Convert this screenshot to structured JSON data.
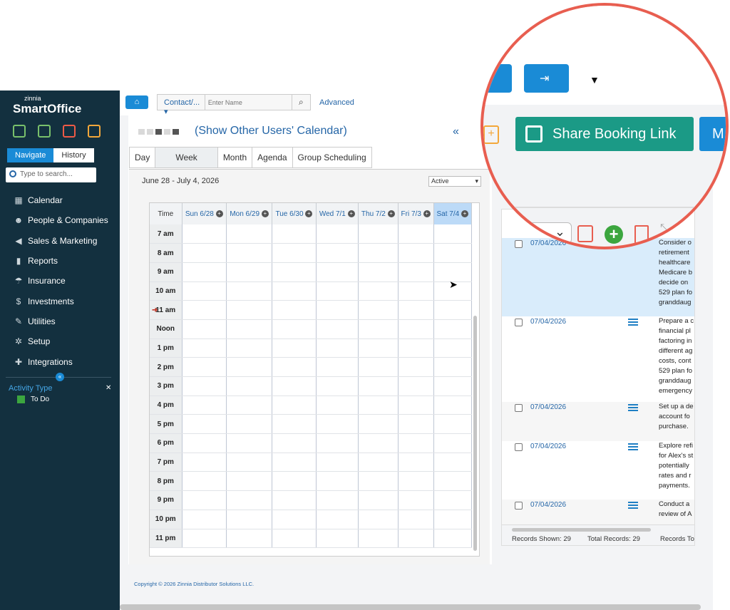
{
  "app": {
    "logo_small": "zinnia",
    "logo_big": "SmartOffice"
  },
  "sidebar": {
    "tab_navigate": "Navigate",
    "tab_history": "History",
    "search_placeholder": "Type to search...",
    "items": [
      {
        "label": "Calendar",
        "icon": "calendar-icon"
      },
      {
        "label": "People & Companies",
        "icon": "people-icon"
      },
      {
        "label": "Sales & Marketing",
        "icon": "megaphone-icon"
      },
      {
        "label": "Reports",
        "icon": "bar-chart-icon"
      },
      {
        "label": "Insurance",
        "icon": "umbrella-icon"
      },
      {
        "label": "Investments",
        "icon": "dollar-icon"
      },
      {
        "label": "Utilities",
        "icon": "wrench-icon"
      },
      {
        "label": "Setup",
        "icon": "gears-icon"
      },
      {
        "label": "Integrations",
        "icon": "puzzle-icon"
      }
    ],
    "activity_type_label": "Activity Type",
    "activity_types": [
      {
        "label": "To Do",
        "color": "#3ca63f"
      }
    ]
  },
  "topbar": {
    "contact_dropdown": "Contact/...",
    "name_placeholder": "Enter Name",
    "advanced_label": "Advanced"
  },
  "calendar": {
    "show_other_users": "(Show Other Users' Calendar)",
    "prev_arrow": "«",
    "view_tabs": [
      "Day",
      "Week",
      "Month",
      "Agenda",
      "Group Scheduling"
    ],
    "active_view": "Week",
    "date_range": "June 28 - July 4, 2026",
    "status_filter": "Active",
    "time_header": "Time",
    "days": [
      "Sun 6/28",
      "Mon 6/29",
      "Tue 6/30",
      "Wed 7/1",
      "Thu 7/2",
      "Fri 7/3",
      "Sat 7/4"
    ],
    "today_index": 6,
    "hours": [
      "7 am",
      "8 am",
      "9 am",
      "10 am",
      "11 am",
      "Noon",
      "1 pm",
      "2 pm",
      "3 pm",
      "4 pm",
      "5 pm",
      "6 pm",
      "7 pm",
      "8 pm",
      "9 pm",
      "10 pm",
      "11 pm"
    ],
    "current_hour": "11 am"
  },
  "records": {
    "rows": [
      {
        "date": "07/04/2026",
        "desc": "Consider o\nretirement\nhealthcare\nMedicare b\ndecide on \n529 plan fo\ngranddaug"
      },
      {
        "date": "07/04/2026",
        "desc": "Prepare a c\nfinancial pl\nfactoring in\ndifferent ag\ncosts, cont\n529 plan fo\ngranddaug\nemergency"
      },
      {
        "date": "07/04/2026",
        "desc": "Set up a de\naccount fo\npurchase."
      },
      {
        "date": "07/04/2026",
        "desc": "Explore refi\nfor Alex's st\npotentially\nrates and r\npayments."
      },
      {
        "date": "07/04/2026",
        "desc": "Conduct a\nreview of A"
      }
    ],
    "records_shown": "Records Shown: 29",
    "total_records": "Total Records: 29",
    "records_to": "Records To"
  },
  "zoom": {
    "share_booking": "Share Booking Link",
    "m_label": "M"
  },
  "footer": {
    "copyright": "Copyright © 2026 Zinnia Distributor Solutions LLC."
  }
}
